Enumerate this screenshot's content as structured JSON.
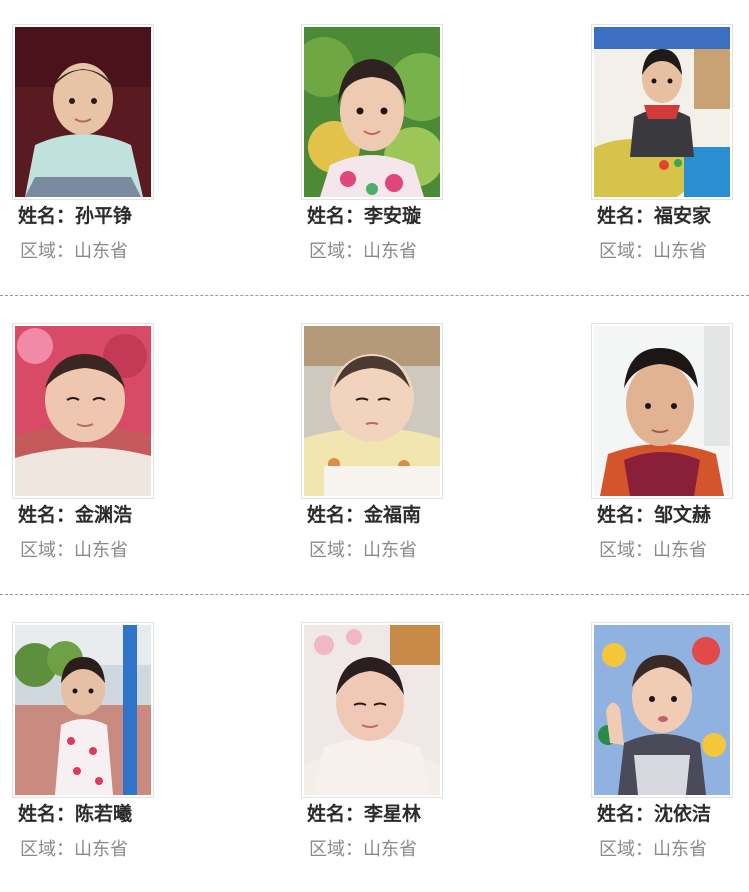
{
  "labels": {
    "name_prefix": "姓名：",
    "region_prefix": "区域："
  },
  "children": [
    {
      "name": "孙平铮",
      "region": "山东省",
      "photo": "child-photo"
    },
    {
      "name": "李安璇",
      "region": "山东省",
      "photo": "child-photo"
    },
    {
      "name": "福安家",
      "region": "山东省",
      "photo": "child-photo"
    },
    {
      "name": "金渊浩",
      "region": "山东省",
      "photo": "child-photo"
    },
    {
      "name": "金福南",
      "region": "山东省",
      "photo": "child-photo"
    },
    {
      "name": "邹文赫",
      "region": "山东省",
      "photo": "child-photo"
    },
    {
      "name": "陈若曦",
      "region": "山东省",
      "photo": "child-photo"
    },
    {
      "name": "李星林",
      "region": "山东省",
      "photo": "child-photo"
    },
    {
      "name": "沈依洁",
      "region": "山东省",
      "photo": "child-photo"
    }
  ],
  "colors": {
    "name_text": "#2b2b2b",
    "region_text": "#8a8a8a",
    "divider": "#9a9a9a",
    "photo_border": "#e2e2e2"
  }
}
